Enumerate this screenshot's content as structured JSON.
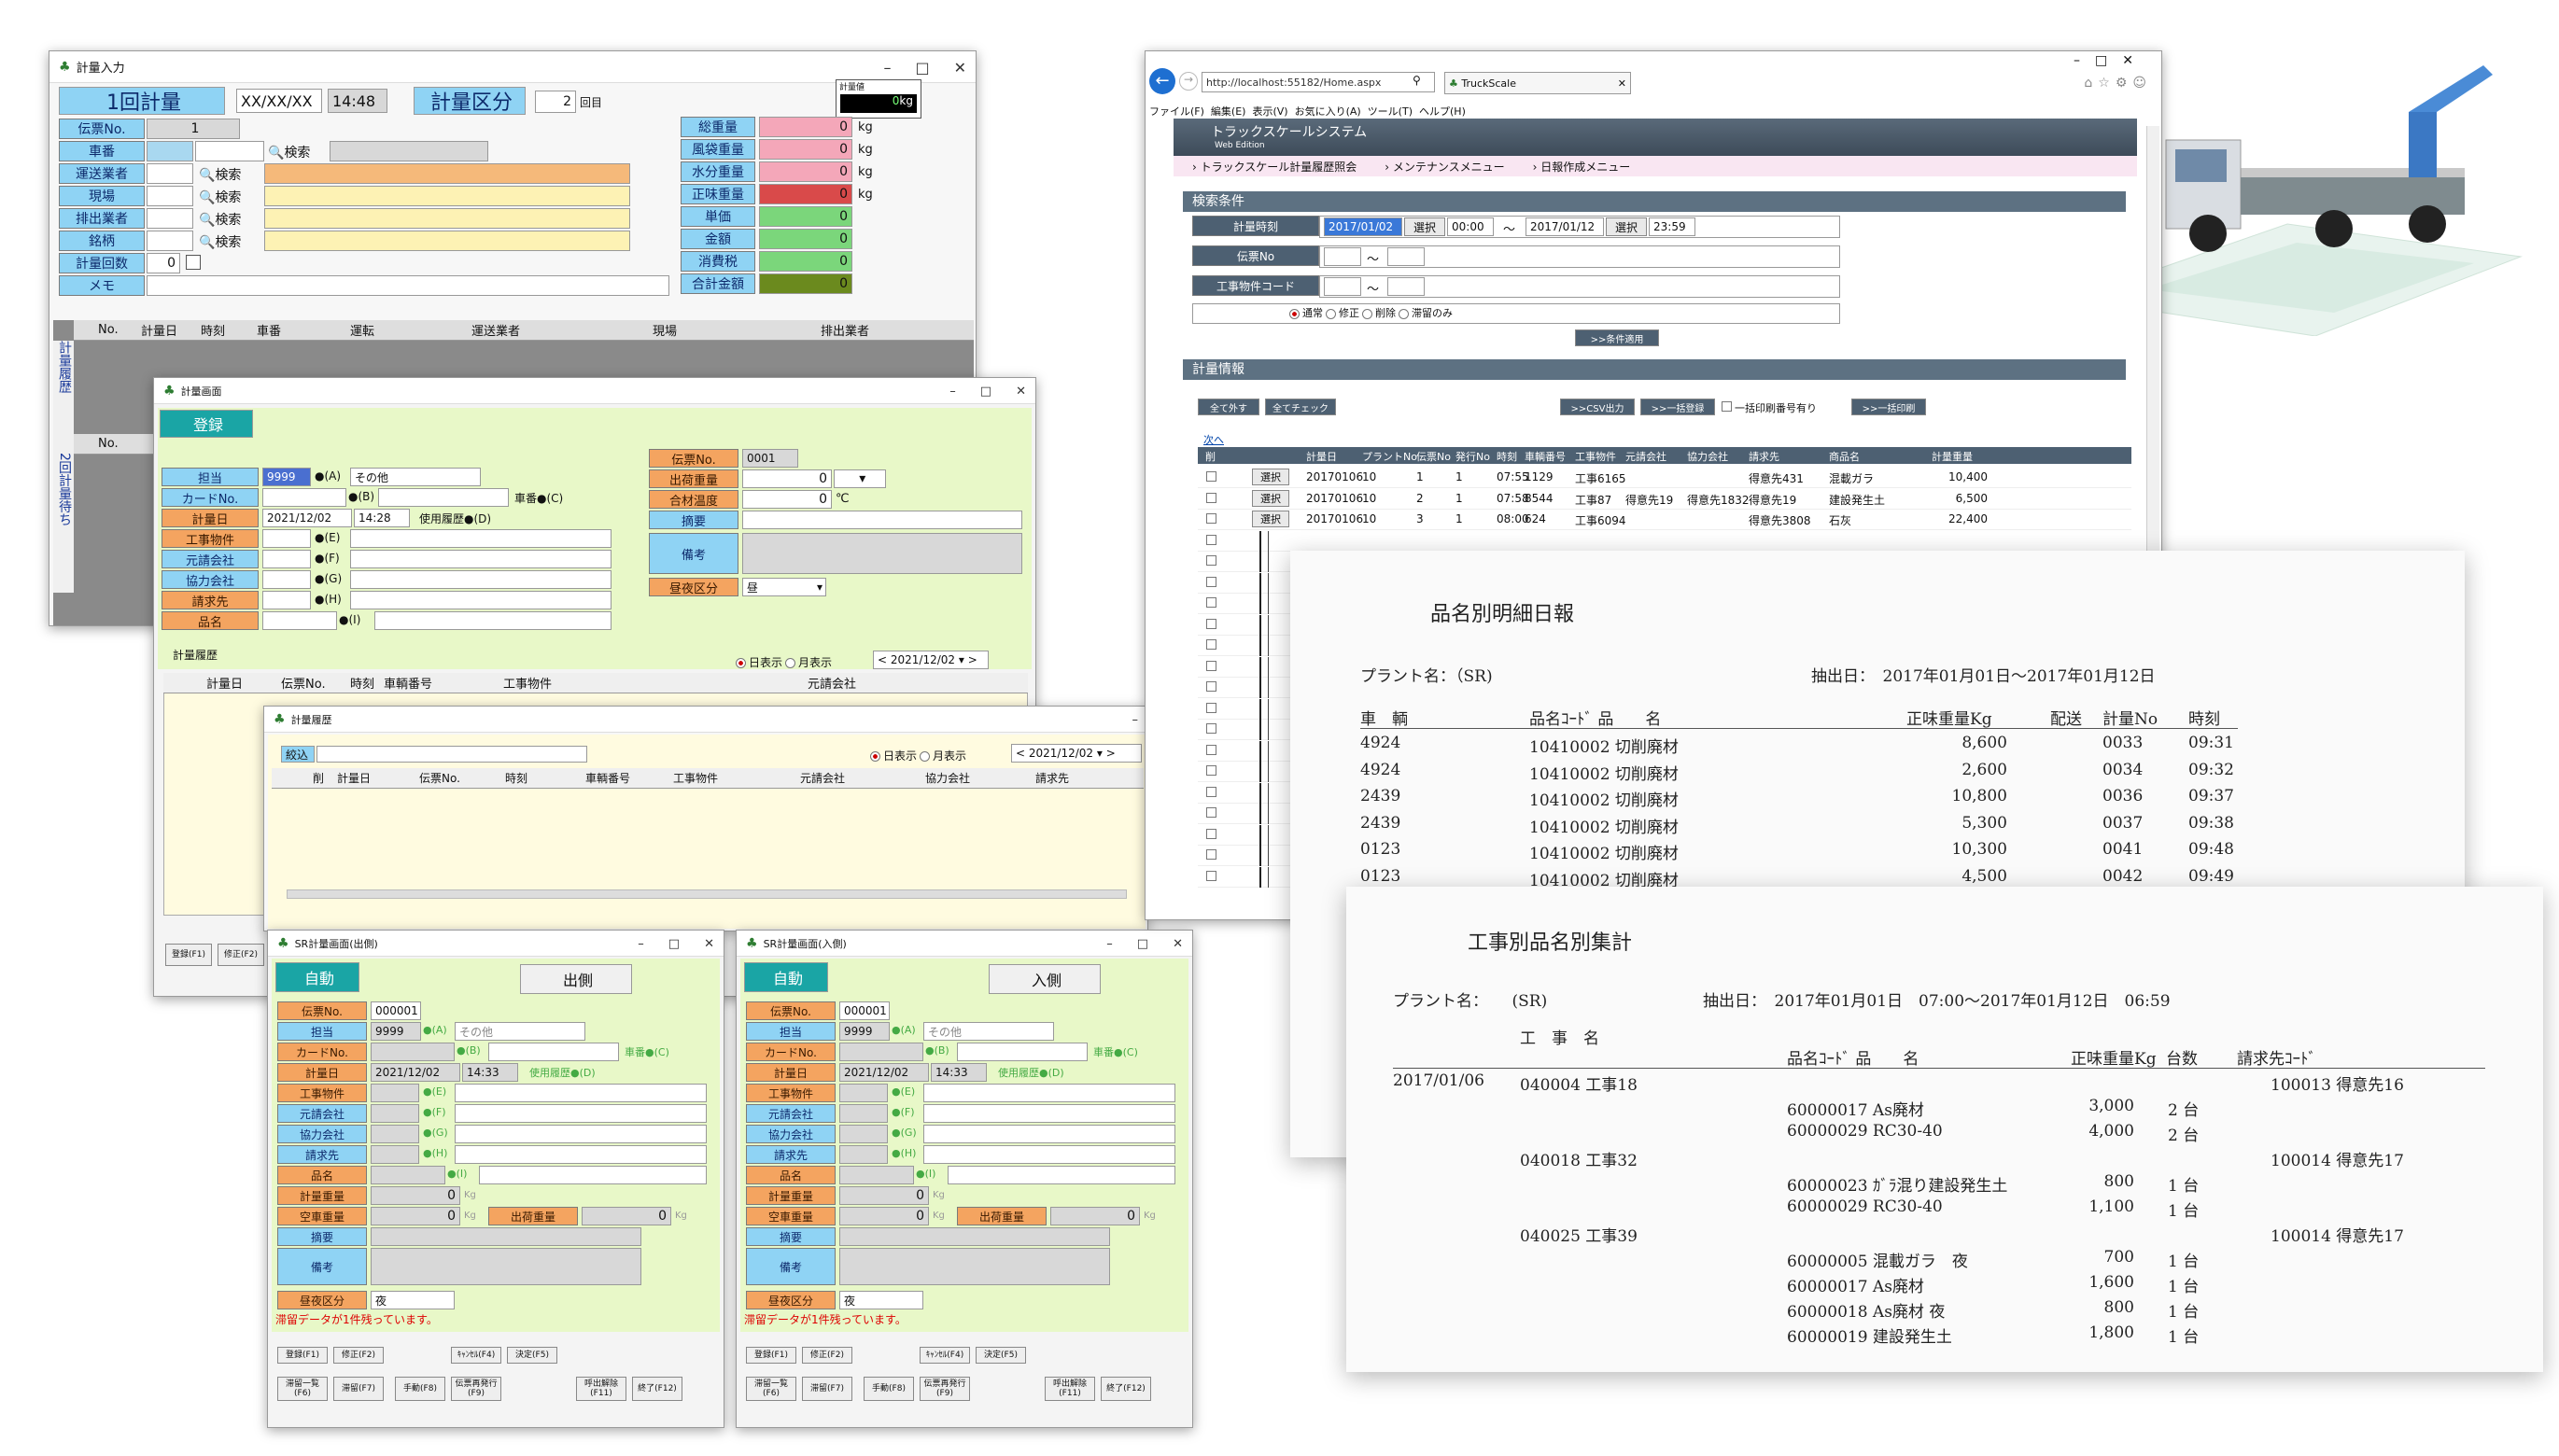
{
  "win1": {
    "title": "計量入力",
    "mode": "1回計量",
    "date": "XX/XX/XX",
    "time": "14:48",
    "kubun_label": "計量区分",
    "kubun_value": "2",
    "kubun_unit": "回目",
    "meter_label": "計量値",
    "meter_value": "0",
    "meter_unit": "kg",
    "left_labels": [
      "伝票No.",
      "車番",
      "運送業者",
      "現場",
      "排出業者",
      "銘柄",
      "計量回数",
      "メモ"
    ],
    "denpyo": "1",
    "count": "0",
    "search": "検索",
    "right_labels": [
      "総重量",
      "風袋重量",
      "水分重量",
      "正味重量",
      "単価",
      "金額",
      "消費税",
      "合計金額"
    ],
    "right_values": [
      "0",
      "0",
      "0",
      "0",
      "0",
      "0",
      "0",
      "0"
    ],
    "kg": "kg",
    "grid_cols": [
      "No.",
      "計量日",
      "時刻",
      "車番",
      "運転",
      "運送業者",
      "現場",
      "排出業者"
    ],
    "side1": "計量履歴",
    "side2": "2回計量待ち",
    "grid2_col": "No."
  },
  "win2": {
    "title": "計量画面",
    "tab": "登録",
    "l_labels": [
      "担当",
      "カードNo.",
      "計量日",
      "工事物件",
      "元請会社",
      "協力会社",
      "請求先",
      "品名"
    ],
    "tanto_code": "9999",
    "tanto_key": "●(A)",
    "tanto_name": "その他",
    "card_key": "●(B)",
    "shaban": "車番●(C)",
    "date": "2021/12/02",
    "time": "14:28",
    "hist": "使用履歴●(D)",
    "keys": [
      "●(E)",
      "●(F)",
      "●(G)",
      "●(H)",
      "●(I)"
    ],
    "r_labels": [
      "伝票No.",
      "出荷重量",
      "合材温度",
      "摘要",
      "備考",
      "昼夜区分"
    ],
    "denpyo": "0001",
    "shukka": "0",
    "ondo": "0",
    "deg": "℃",
    "chuya": "昼",
    "hist_title": "計量履歴",
    "day_view": "日表示",
    "month_view": "月表示",
    "hist_date": "2021/12/02",
    "hist_cols": [
      "計量日",
      "伝票No.",
      "時刻",
      "車輌番号",
      "工事物件",
      "元請会社"
    ],
    "fkeys": [
      "登録(F1)",
      "修正(F2)"
    ]
  },
  "win3": {
    "title": "計量履歴",
    "filter": "絞込",
    "day_view": "日表示",
    "month_view": "月表示",
    "date": "2021/12/02",
    "cols": [
      "削",
      "計量日",
      "伝票No.",
      "時刻",
      "車輌番号",
      "工事物件",
      "元請会社",
      "協力会社",
      "請求先"
    ]
  },
  "sr_out": {
    "title": "SR計量画面(出側)",
    "mode": "自動",
    "side": "出側"
  },
  "sr_in": {
    "title": "SR計量画面(入側)",
    "mode": "自動",
    "side": "入側"
  },
  "sr_common": {
    "labels": [
      "伝票No.",
      "担当",
      "カードNo.",
      "計量日",
      "工事物件",
      "元請会社",
      "協力会社",
      "請求先",
      "品名",
      "計量重量",
      "空車重量",
      "摘要",
      "備考",
      "昼夜区分"
    ],
    "denpyo": "000001",
    "tanto": "9999",
    "tanto_key": "●(A)",
    "tanto_name": "その他",
    "card_key": "●(B)",
    "shaban": "車番●(C)",
    "date": "2021/12/02",
    "time": "14:33",
    "hist": "使用履歴●(D)",
    "keys": [
      "●(E)",
      "●(F)",
      "●(G)",
      "●(H)",
      "●(I)"
    ],
    "w1": "0",
    "w2": "0",
    "w3": "0",
    "kg": "Kg",
    "shukka": "出荷重量",
    "chuya": "夜",
    "warning": "滞留データが1件残っています。",
    "fk1": [
      "登録(F1)",
      "修正(F2)",
      "ｷｬﾝｾﾙ(F4)",
      "決定(F5)"
    ],
    "fk2": [
      "滞留一覧(F6)",
      "滞留(F7)",
      "手動(F8)",
      "伝票再発行(F9)",
      "呼出解除(F11)",
      "終了(F12)"
    ]
  },
  "browser": {
    "url": "http://localhost:55182/Home.aspx",
    "tab": "TruckScale",
    "menu": [
      "ファイル(F)",
      "編集(E)",
      "表示(V)",
      "お気に入り(A)",
      "ツール(T)",
      "ヘルプ(H)"
    ],
    "app_title": "トラックスケールシステム",
    "app_sub": "Web Edition",
    "nav": [
      "トラックスケール計量履歴照会",
      "メンテナンスメニュー",
      "日報作成メニュー"
    ],
    "search_title": "検索条件",
    "s_labels": [
      "計量時刻",
      "伝票No",
      "工事物件コード"
    ],
    "d1": "2017/01/02",
    "t1": "00:00",
    "tilde": "〜",
    "d2": "2017/01/12",
    "t2": "23:59",
    "select": "選択",
    "radios": [
      "通常",
      "修正",
      "削除",
      "滞留のみ"
    ],
    "apply": ">>条件適用",
    "info_title": "計量情報",
    "btns": [
      "全て外す",
      "全てチェック"
    ],
    "btns2": [
      ">>CSV出力",
      ">>一括登録"
    ],
    "print_chk": "一括印刷番号有り",
    ">>一括印刷": "",
    "print_btn": ">>一括印刷",
    "next": "次へ",
    "cols": [
      "削",
      "計量日",
      "プラントNo",
      "伝票No",
      "発行No",
      "時刻",
      "車輌番号",
      "工事物件",
      "元請会社",
      "協力会社",
      "請求先",
      "商品名",
      "計量重量"
    ],
    "rows": [
      [
        "20170106",
        "10",
        "1",
        "1",
        "07:55",
        "1129",
        "工事6165",
        "",
        "",
        "得意先431",
        "混載ガラ",
        "10,400"
      ],
      [
        "20170106",
        "10",
        "2",
        "1",
        "07:58",
        "8544",
        "工事87",
        "得意先19",
        "得意先1832",
        "得意先19",
        "建設発生土",
        "6,500"
      ],
      [
        "20170106",
        "10",
        "3",
        "1",
        "08:00",
        "624",
        "工事6094",
        "",
        "",
        "得意先3808",
        "石灰",
        "22,400"
      ]
    ]
  },
  "report1": {
    "title": "品名別明細日報",
    "plant": "プラント名：（SR)",
    "range": "抽出日：　2017年01月01日〜2017年01月12日",
    "cols": [
      "車　輌",
      "品名ｺｰﾄﾞ 品　　名",
      "正味重量Kg",
      "配送",
      "計量No",
      "時刻"
    ],
    "rows": [
      [
        "4924",
        "10410002 切削廃材",
        "8,600",
        "",
        "0033",
        "09:31"
      ],
      [
        "4924",
        "10410002 切削廃材",
        "2,600",
        "",
        "0034",
        "09:32"
      ],
      [
        "2439",
        "10410002 切削廃材",
        "10,800",
        "",
        "0036",
        "09:37"
      ],
      [
        "2439",
        "10410002 切削廃材",
        "5,300",
        "",
        "0037",
        "09:38"
      ],
      [
        "0123",
        "10410002 切削廃材",
        "10,300",
        "",
        "0041",
        "09:48"
      ],
      [
        "0123",
        "10410002 切削廃材",
        "4,500",
        "",
        "0042",
        "09:49"
      ]
    ]
  },
  "report2": {
    "title": "工事別品名別集計",
    "plant": "プラント名：　　(SR)",
    "range": "抽出日：　2017年01月01日　07:00〜2017年01月12日　06:59",
    "col_koji": "工　事　名",
    "cols": [
      "品名ｺｰﾄﾞ 品　　名",
      "正味重量Kg",
      "台数",
      "請求先ｺｰﾄﾞ"
    ],
    "date": "2017/01/06",
    "groups": [
      {
        "koji": "040004 工事18",
        "seikyu": "100013 得意先16",
        "items": [
          [
            "60000017 As廃材",
            "3,000",
            "2 台"
          ],
          [
            "60000029 RC30-40",
            "4,000",
            "2 台"
          ]
        ]
      },
      {
        "koji": "040018 工事32",
        "seikyu": "100014 得意先17",
        "items": [
          [
            "60000023 ｶﾞﾗ混り建設発生土",
            "800",
            "1 台"
          ],
          [
            "60000029 RC30-40",
            "1,100",
            "1 台"
          ]
        ]
      },
      {
        "koji": "040025 工事39",
        "seikyu": "100014 得意先17",
        "items": [
          [
            "60000005 混載ガラ　夜",
            "700",
            "1 台"
          ],
          [
            "60000017 As廃材",
            "1,600",
            "1 台"
          ],
          [
            "60000018 As廃材 夜",
            "800",
            "1 台"
          ],
          [
            "60000019 建設発生土",
            "1,800",
            "1 台"
          ]
        ]
      }
    ]
  }
}
